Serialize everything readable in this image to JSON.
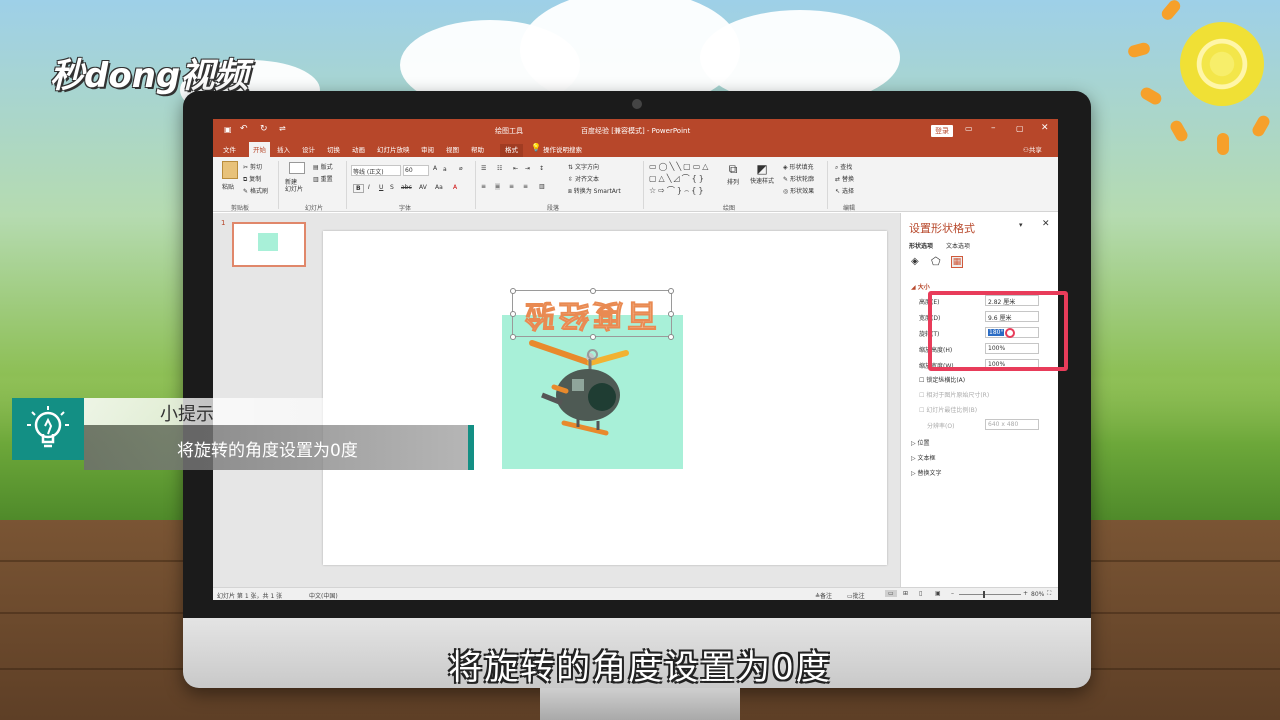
{
  "brand": {
    "logo_text": "秒dong视频"
  },
  "ppt": {
    "title": "百度经验 [兼容模式] - PowerPoint",
    "context_tab_group": "绘图工具",
    "login_label": "登录",
    "share_label": "共享",
    "tabs": [
      "文件",
      "开始",
      "插入",
      "设计",
      "切换",
      "动画",
      "幻灯片放映",
      "审阅",
      "视图",
      "帮助",
      "格式"
    ],
    "search_label": "操作说明搜索",
    "ribbon": {
      "paste": "粘贴",
      "cut": "剪切",
      "copy": "复制",
      "format_painter": "格式刷",
      "clipboard_group": "剪贴板",
      "new_slide": "新建\n幻灯片",
      "layout": "版式",
      "reset": "重置",
      "slides_group": "幻灯片",
      "font_name": "等线 (正文)",
      "font_size": "60",
      "font_group": "字体",
      "text_direction": "文字方向",
      "align_text": "对齐文本",
      "smartart": "转换为 SmartArt",
      "paragraph_group": "段落",
      "arrange": "排列",
      "quick_styles": "快速样式",
      "shape_fill": "形状填充",
      "shape_outline": "形状轮廓",
      "shape_effects": "形状效果",
      "drawing_group": "绘图",
      "find": "查找",
      "replace": "替换",
      "select": "选择",
      "editing_group": "编辑"
    },
    "thumb_number": "1",
    "slide_text": "百度经验",
    "pane": {
      "title": "设置形状格式",
      "tab_shape": "形状选项",
      "tab_text": "文本选项",
      "section_size": "大小",
      "height_label": "高度(E)",
      "height_value": "2.82 厘米",
      "width_label": "宽度(D)",
      "width_value": "9.6 厘米",
      "rotation_label": "旋转(T)",
      "rotation_value": "180°",
      "scale_height_label": "缩放高度(H)",
      "scale_height_value": "100%",
      "scale_width_label": "缩放宽度(W)",
      "scale_width_value": "100%",
      "lock_ratio": "锁定纵横比(A)",
      "relative_original": "相对于图片原始尺寸(R)",
      "best_scale": "幻灯片最佳比例(B)",
      "resolution_label": "分辨率(O)",
      "resolution_value": "640 x 480",
      "position": "位置",
      "textbox": "文本框",
      "alt_text": "替换文字"
    },
    "status": {
      "slide_info": "幻灯片 第 1 张，共 1 张",
      "language": "中文(中国)",
      "notes": "备注",
      "comments": "批注",
      "zoom": "80%"
    }
  },
  "tip": {
    "heading": "小提示",
    "body": "将旋转的角度设置为0度"
  },
  "subtitle": "将旋转的角度设置为0度",
  "colors": {
    "ppt_accent": "#b7472a",
    "tip_teal": "#138f84",
    "highlight_red": "#e83c5a",
    "slide_block": "#a8f0d8"
  }
}
